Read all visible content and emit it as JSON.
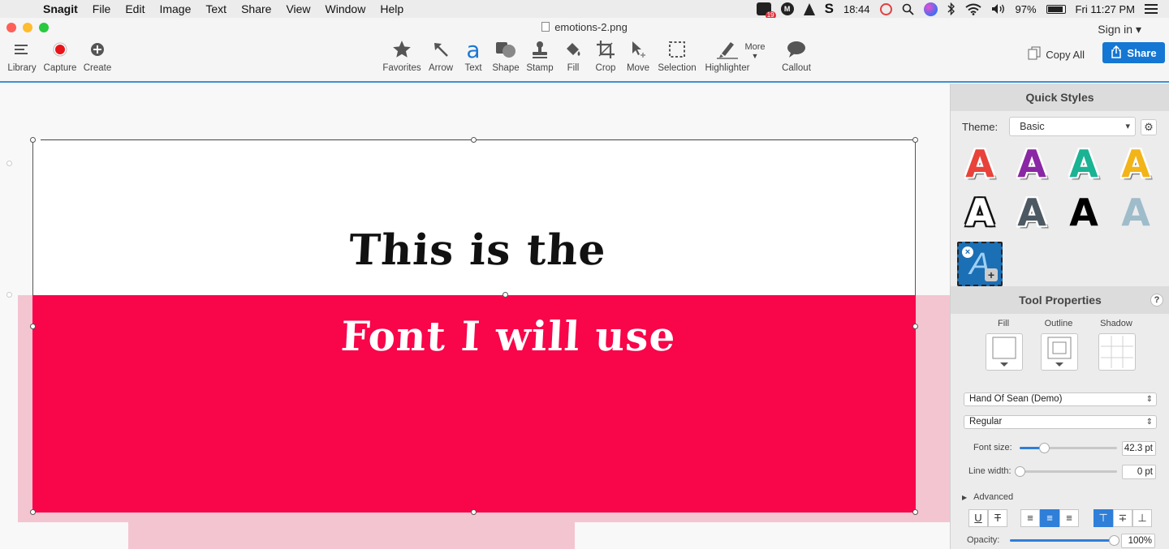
{
  "menubar": {
    "app_name": "Snagit",
    "items": [
      "File",
      "Edit",
      "Image",
      "Text",
      "Share",
      "View",
      "Window",
      "Help"
    ],
    "status": {
      "badge_count": "19",
      "circle_letter": "M",
      "clock": "18:44",
      "battery": "97%",
      "datetime": "Fri 11:27 PM"
    }
  },
  "window": {
    "title": "emotions-2.png",
    "sign_in": "Sign in ▾"
  },
  "toolbar": {
    "left": [
      {
        "label": "Library",
        "icon": "menu-icon"
      },
      {
        "label": "Capture",
        "icon": "record-icon"
      },
      {
        "label": "Create",
        "icon": "plus-circle-icon"
      }
    ],
    "tools": [
      {
        "label": "Favorites",
        "icon": "star-icon"
      },
      {
        "label": "Arrow",
        "icon": "arrow-icon"
      },
      {
        "label": "Text",
        "icon": "text-a-icon"
      },
      {
        "label": "Shape",
        "icon": "shape-icon"
      },
      {
        "label": "Stamp",
        "icon": "stamp-icon"
      },
      {
        "label": "Fill",
        "icon": "fill-bucket-icon"
      },
      {
        "label": "Crop",
        "icon": "crop-icon"
      },
      {
        "label": "Move",
        "icon": "move-icon"
      },
      {
        "label": "Selection",
        "icon": "selection-icon"
      },
      {
        "label": "Highlighter",
        "icon": "highlighter-icon"
      },
      {
        "label": "Callout",
        "icon": "callout-icon"
      }
    ],
    "more_label": "More",
    "copy_all": "Copy All",
    "share": "Share"
  },
  "canvas": {
    "line1": "This is the",
    "line2": "Font I will use"
  },
  "panel": {
    "quick_styles_title": "Quick Styles",
    "theme_label": "Theme:",
    "theme_value": "Basic",
    "style_letter": "A",
    "style_colors": [
      "#e8423a",
      "#8a27a4",
      "#1ab394",
      "#f2b418",
      "#ffffff",
      "#4c5963",
      "#000000",
      "#9fbccb"
    ],
    "add_style_letter": "A",
    "tool_properties_title": "Tool Properties",
    "help": "?",
    "fill_label": "Fill",
    "outline_label": "Outline",
    "shadow_label": "Shadow",
    "font_family": "Hand Of Sean (Demo)",
    "font_style": "Regular",
    "font_size_label": "Font size:",
    "font_size_value": "42.3 pt",
    "font_size_level": 0.25,
    "line_width_label": "Line width:",
    "line_width_value": "0 pt",
    "line_width_level": 0,
    "advanced_label": "Advanced",
    "opacity_label": "Opacity:",
    "opacity_value": "100%",
    "opacity_level": 1.0
  },
  "colors": {
    "accent": "#1477d3",
    "canvas_red": "#f8054a",
    "canvas_pink": "#f3c5d1"
  }
}
